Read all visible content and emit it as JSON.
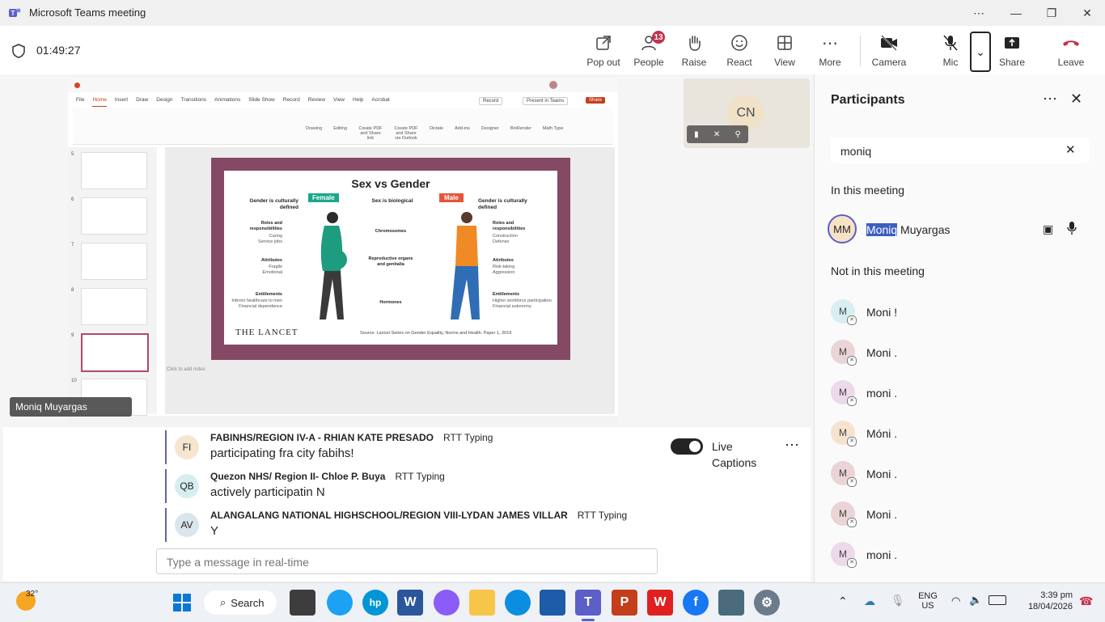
{
  "window": {
    "title": "Microsoft Teams meeting"
  },
  "meeting": {
    "timer": "01:49:27"
  },
  "toolbar": {
    "popout": "Pop out",
    "people": "People",
    "people_count": "13",
    "raise": "Raise",
    "react": "React",
    "view": "View",
    "more": "More",
    "camera": "Camera",
    "mic": "Mic",
    "share": "Share",
    "leave": "Leave"
  },
  "share": {
    "presenter": "Moniq Muyargas",
    "ribbon_tabs": [
      "File",
      "Home",
      "Insert",
      "Draw",
      "Design",
      "Transitions",
      "Animations",
      "Slide Show",
      "Record",
      "Review",
      "View",
      "Help",
      "Acrobat"
    ],
    "record_label": "Record",
    "present_in_teams": "Present in Teams",
    "share_btn": "Share",
    "ribbon_tools": [
      "Drawing",
      "Editing",
      "Create PDF and Share link",
      "Create PDF and Share via Outlook",
      "Dictate",
      "Add-ins",
      "Designer",
      "BioRender",
      "Math Type"
    ],
    "notes_placeholder": "Click to add notes",
    "slide": {
      "title": "Sex vs Gender",
      "female": "Female",
      "male": "Male",
      "sex_biological": "Sex is biological",
      "gender_left": "Gender is culturally defined",
      "gender_right": "Gender is culturally defined",
      "roles_left": "Roles and responsibilities",
      "roles_left_items": "Caring\nService jobs",
      "roles_right": "Roles and responsibilities",
      "roles_right_items": "Construction\nDefense",
      "chromosomes": "Chromosomes",
      "attr_left": "Attributes",
      "attr_left_items": "Fragile\nEmotional",
      "repro": "Reproductive organs and genitalia",
      "attr_right": "Attributes",
      "attr_right_items": "Risk-taking\nAggression",
      "ent_left": "Entitlements",
      "ent_left_items": "Inferior healthcare to men\nFinancial dependence",
      "hormones": "Hormones",
      "ent_right": "Entitlements",
      "ent_right_items": "Higher workforce participation\nFinancial autonomy",
      "journal": "THE LANCET",
      "source": "Source: Lancet Series on Gender Equality, Norms and Health. Paper 1, 2019"
    },
    "thumbs": [
      "5",
      "6",
      "7",
      "8",
      "9",
      "10"
    ]
  },
  "tile": {
    "initials": "CN"
  },
  "participants": {
    "header": "Participants",
    "search_value": "moniq",
    "in_meeting_label": "In this meeting",
    "in_meeting": [
      {
        "initials": "MM",
        "highlight": "Moniq",
        "rest": " Muyargas"
      }
    ],
    "not_in_meeting_label": "Not in this meeting",
    "not_in_meeting": [
      {
        "initials": "M",
        "name": "Moni !",
        "color": "#d9eef2"
      },
      {
        "initials": "M",
        "name": "Moni .",
        "color": "#ead4d6"
      },
      {
        "initials": "M",
        "name": "moni .",
        "color": "#ecd9ea"
      },
      {
        "initials": "M",
        "name": "Móni .",
        "color": "#f6e3cf"
      },
      {
        "initials": "M",
        "name": "Moni .",
        "color": "#ead4d6"
      },
      {
        "initials": "M",
        "name": "Moni .",
        "color": "#ead4d6"
      },
      {
        "initials": "M",
        "name": "moni .",
        "color": "#ecd9ea"
      }
    ]
  },
  "captions": {
    "live_label": "Live",
    "captions_label": "Captions",
    "input_placeholder": "Type a message in real-time",
    "lines": [
      {
        "initials": "FI",
        "speaker": "FABINHS/REGION IV-A - RHIAN KATE PRESADO",
        "status": "RTT Typing",
        "text": "participating fra city fabihs!",
        "color": "#f6e6d0"
      },
      {
        "initials": "QB",
        "speaker": "Quezon NHS/ Region II- Chloe P. Buya",
        "status": "RTT Typing",
        "text": "actively participatin N",
        "color": "#d6eef0"
      },
      {
        "initials": "AV",
        "speaker": "ALANGALANG NATIONAL HIGHSCHOOL/REGION VIII-LYDAN JAMES VILLAR",
        "status": "RTT Typing",
        "text": "Y",
        "color": "#dbe6ec"
      }
    ]
  },
  "taskbar": {
    "weather": "32°",
    "search": "Search",
    "lang1": "ENG",
    "lang2": "US",
    "time": "3:39 pm",
    "date": "18/04/2026"
  }
}
